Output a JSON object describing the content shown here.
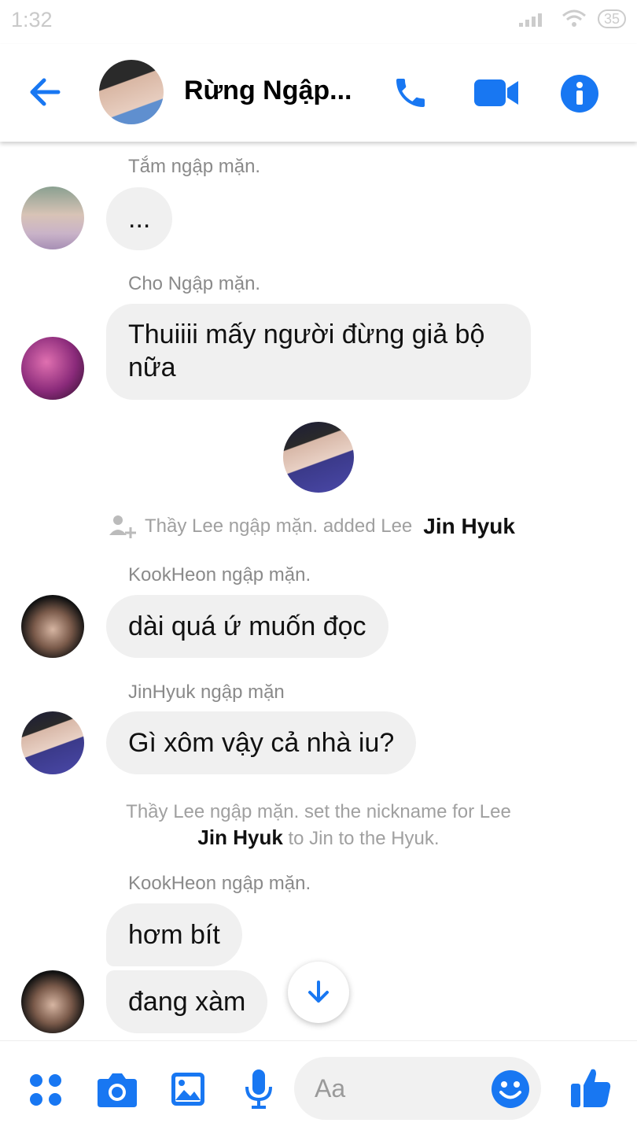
{
  "status_bar": {
    "time": "1:32",
    "battery": "35"
  },
  "header": {
    "title": "Rừng Ngập..."
  },
  "messages": [
    {
      "sender": "Tắm ngập mặn.",
      "text": "..."
    },
    {
      "sender": "Cho Ngập mặn.",
      "line1": "Thuiiii mấy người đừng giả bộ",
      "line2": "nữa"
    },
    {
      "sender": "KookHeon ngập mặn.",
      "text": "dài quá ứ muốn đọc"
    },
    {
      "sender": "JinHyuk ngập mặn",
      "text": "Gì xôm vậy cả nhà iu?"
    },
    {
      "sender": "KookHeon ngập mặn.",
      "text1": "hơm bít",
      "text2": "đang xàm"
    }
  ],
  "system": {
    "added": {
      "prefix": "Thầy Lee ngập mặn. added Lee",
      "name": "Jin Hyuk"
    },
    "nickname": {
      "line1": "Thầy Lee ngập mặn. set the nickname for Lee",
      "name": "Jin Hyuk",
      "suffix": "to Jin to the Hyuk."
    }
  },
  "composer": {
    "placeholder": "Aa"
  },
  "colors": {
    "accent": "#1877f2",
    "bubble": "#f0f0f0"
  },
  "icons": [
    "back-arrow-icon",
    "phone-icon",
    "video-icon",
    "info-icon",
    "menu-dots-icon",
    "camera-icon",
    "image-icon",
    "mic-icon",
    "emoji-icon",
    "like-icon",
    "scroll-down-icon",
    "add-person-icon"
  ]
}
